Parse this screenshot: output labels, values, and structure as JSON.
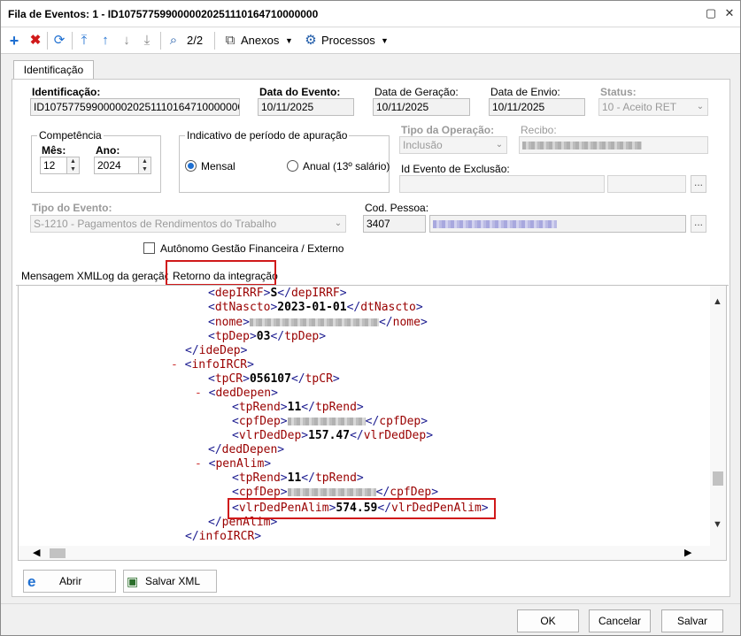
{
  "window": {
    "title": "Fila de Eventos: 1 - ID1075775990000020251110164710000000"
  },
  "toolbar": {
    "page_indicator": "2/2",
    "attachments_label": "Anexos",
    "processes_label": "Processos"
  },
  "tabs": {
    "identification": "Identificação"
  },
  "form": {
    "identificacao_label": "Identificação:",
    "identificacao_value": "ID1075775990000020251110164710000000",
    "data_evento_label": "Data do Evento:",
    "data_evento_value": "10/11/2025",
    "data_geracao_label": "Data de Geração:",
    "data_geracao_value": "10/11/2025",
    "data_envio_label": "Data de Envio:",
    "data_envio_value": "10/11/2025",
    "status_label": "Status:",
    "status_value": "10 - Aceito RET",
    "competencia_label": "Competência",
    "mes_label": "Mês:",
    "mes_value": "12",
    "ano_label": "Ano:",
    "ano_value": "2024",
    "indicativo_label": "Indicativo de período de apuração",
    "mensal_label": "Mensal",
    "anual_label": "Anual (13º salário)",
    "tipo_operacao_label": "Tipo da Operação:",
    "tipo_operacao_value": "Inclusão",
    "recibo_label": "Recibo:",
    "id_exclusao_label": "Id Evento de Exclusão:",
    "tipo_evento_label": "Tipo do Evento:",
    "tipo_evento_value": "S-1210 - Pagamentos de Rendimentos do Trabalho",
    "cod_pessoa_label": "Cod. Pessoa:",
    "cod_pessoa_value": "3407",
    "autonomo_label": "Autônomo Gestão Financeira / Externo",
    "dots": "..."
  },
  "subtabs": {
    "xml": "Mensagem XML",
    "log": "Log da geração",
    "retorno": "Retorno da integração"
  },
  "xml": {
    "depIRRF_tag": "depIRRF",
    "depIRRF_val": "S",
    "dtNascto_tag": "dtNascto",
    "dtNascto_val": "2023-01-01",
    "nome_tag": "nome",
    "tpDep_tag": "tpDep",
    "tpDep_val": "03",
    "ideDep_tag": "ideDep",
    "infoIRCR_tag": "infoIRCR",
    "tpCR_tag": "tpCR",
    "tpCR_val": "056107",
    "dedDepen_tag": "dedDepen",
    "tpRend_tag": "tpRend",
    "tpRend_val": "11",
    "cpfDep_tag": "cpfDep",
    "vlrDedDep_tag": "vlrDedDep",
    "vlrDedDep_val": "157.47",
    "penAlim_tag": "penAlim",
    "tpRend2_val": "11",
    "vlrDedPenAlim_tag": "vlrDedPenAlim",
    "vlrDedPenAlim_val": "574.59",
    "minus": "-"
  },
  "bottom": {
    "abrir": "Abrir",
    "salvar_xml": "Salvar XML"
  },
  "footer": {
    "ok": "OK",
    "cancel": "Cancelar",
    "save": "Salvar"
  },
  "colors": {
    "highlight": "#d0191a",
    "tag": "#990000",
    "bracket": "#1b1b8f",
    "accent": "#1e6fd1"
  }
}
